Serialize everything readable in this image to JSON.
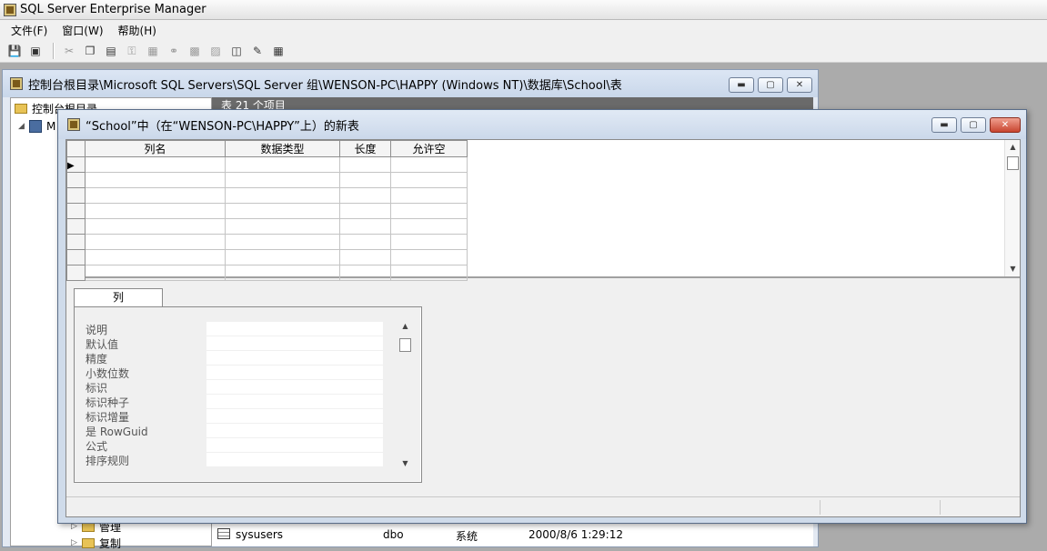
{
  "app": {
    "title": "SQL Server Enterprise Manager",
    "menu": [
      "文件(F)",
      "窗口(W)",
      "帮助(H)"
    ]
  },
  "toolbar": {
    "buttons": [
      "save-icon",
      "properties-icon",
      "cut-icon",
      "copy-icon",
      "paste-icon",
      "key-icon",
      "index-icon",
      "relationship-icon",
      "constraint-icon",
      "trigger-icon",
      "diagram-icon",
      "generate-script-icon",
      "grid-icon"
    ]
  },
  "bg_window": {
    "title": "控制台根目录\\Microsoft SQL Servers\\SQL Server 组\\WENSON-PC\\HAPPY (Windows NT)\\数据库\\School\\表",
    "tree": [
      {
        "label": "控制台根目录",
        "icon": "folder-icon"
      },
      {
        "label": "M",
        "icon": "server-icon"
      },
      {
        "label": "管理",
        "icon": "folder-icon"
      },
      {
        "label": "复制",
        "icon": "folder-icon"
      }
    ],
    "list_header": "表    21 个项目",
    "rows": [
      {
        "name": "sysusers",
        "owner": "dbo",
        "type": "系统",
        "created": "2000/8/6 1:29:12"
      }
    ]
  },
  "fg_window": {
    "title": "“School”中（在“WENSON-PC\\HAPPY”上）的新表",
    "columns": [
      "列名",
      "数据类型",
      "长度",
      "允许空"
    ],
    "tab": "列",
    "properties": [
      "说明",
      "默认值",
      "精度",
      "小数位数",
      "标识",
      "标识种子",
      "标识增量",
      "是 RowGuid",
      "公式",
      "排序规则"
    ]
  },
  "colors": {
    "title_bg": "#cbd8ea",
    "close_red": "#c8452f",
    "list_header_bg": "#6a6a6a"
  }
}
